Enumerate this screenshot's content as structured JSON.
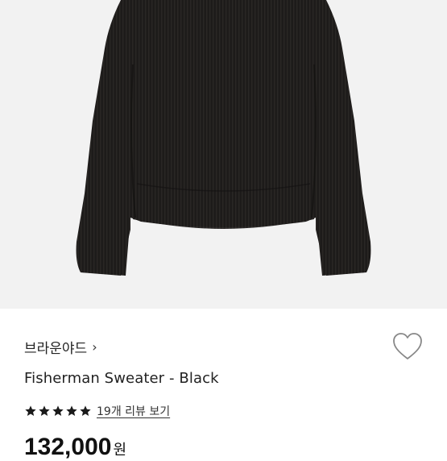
{
  "product": {
    "image_alt": "black ribbed knit sweater",
    "brand": "브라운야드",
    "brand_chevron": "›",
    "title": "Fisherman Sweater - Black",
    "rating_stars": 5,
    "reviews_link": "19개 리뷰 보기",
    "price": "132,000",
    "price_unit": "원"
  },
  "icons": {
    "heart": "heart-outline-icon",
    "star": "star-filled-icon",
    "chevron": "chevron-right-icon"
  },
  "colors": {
    "photo_background": "#f2f2f2",
    "sweater": "#1c1a19",
    "text": "#222222",
    "star": "#1a1a1a"
  }
}
